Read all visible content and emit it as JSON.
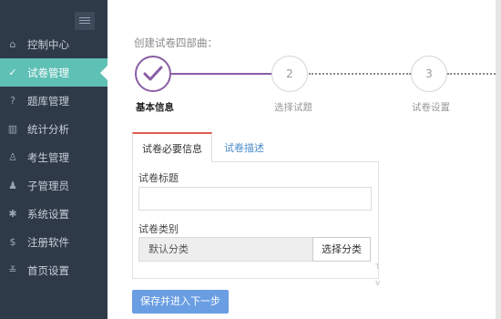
{
  "sidebar": {
    "items": [
      {
        "label": "控制中心",
        "icon": "home-icon",
        "glyph": "⌂"
      },
      {
        "label": "试卷管理",
        "icon": "check-circle-icon",
        "glyph": "✓",
        "active": true
      },
      {
        "label": "题库管理",
        "icon": "question-circle-icon",
        "glyph": "?"
      },
      {
        "label": "统计分析",
        "icon": "bar-chart-icon",
        "glyph": "▥"
      },
      {
        "label": "考生管理",
        "icon": "user-group-icon",
        "glyph": "♙"
      },
      {
        "label": "子管理员",
        "icon": "user-icon",
        "glyph": "♟"
      },
      {
        "label": "系统设置",
        "icon": "gear-icon",
        "glyph": "✱"
      },
      {
        "label": "注册软件",
        "icon": "dollar-icon",
        "glyph": "$"
      },
      {
        "label": "首页设置",
        "icon": "settings-sliders-icon",
        "glyph": "≚"
      }
    ]
  },
  "content": {
    "title": "创建试卷四部曲：",
    "steps": [
      {
        "number": "",
        "label": "基本信息"
      },
      {
        "number": "2",
        "label": "选择试题"
      },
      {
        "number": "3",
        "label": "试卷设置"
      }
    ],
    "tabs": [
      {
        "label": "试卷必要信息"
      },
      {
        "label": "试卷描述"
      }
    ],
    "form": {
      "title_label": "试卷标题",
      "title_value": "",
      "category_label": "试卷类别",
      "category_value": "默认分类",
      "select_button": "选择分类"
    },
    "save_button": "保存并进入下一步"
  },
  "colors": {
    "sidebar_bg": "#2f3a48",
    "active": "#5fc0b6",
    "step_done": "#8a5ea5",
    "tab_accent": "#e05a55",
    "primary_button": "#6a9ee3"
  }
}
